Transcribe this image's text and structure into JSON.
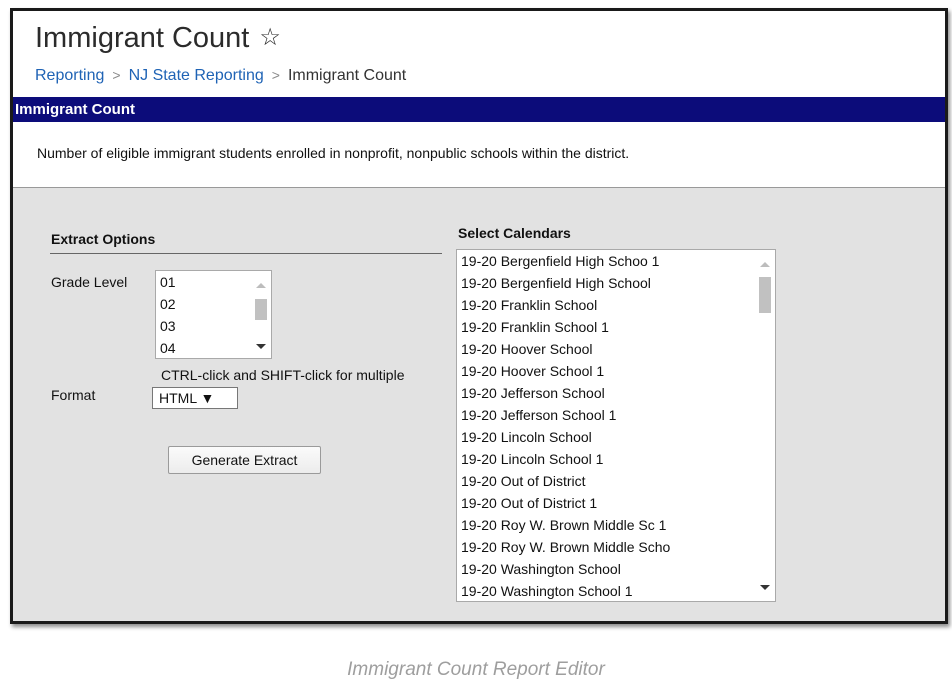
{
  "header": {
    "title": "Immigrant Count",
    "star_icon": "star-outline-icon",
    "breadcrumb": [
      "Reporting",
      "NJ State Reporting",
      "Immigrant Count"
    ],
    "separator": ">"
  },
  "section_bar": {
    "title": "Immigrant Count",
    "color": "#0c0c7a"
  },
  "description": "Number of eligible immigrant students enrolled in nonprofit, nonpublic schools within the district.",
  "extract_options": {
    "heading": "Extract Options",
    "grade_level_label": "Grade Level",
    "grade_levels": [
      "01",
      "02",
      "03",
      "04"
    ],
    "multi_hint": "CTRL-click and SHIFT-click for multiple",
    "format_label": "Format",
    "format_value": "HTML ▼",
    "generate_button": "Generate Extract"
  },
  "calendars": {
    "heading": "Select Calendars",
    "items": [
      "19-20 Bergenfield High Schoo 1",
      "19-20 Bergenfield High School",
      "19-20 Franklin School",
      "19-20 Franklin School 1",
      "19-20 Hoover School",
      "19-20 Hoover School 1",
      "19-20 Jefferson School",
      "19-20 Jefferson School 1",
      "19-20 Lincoln School",
      "19-20 Lincoln School 1",
      "19-20 Out of District",
      "19-20 Out of District 1",
      "19-20 Roy W. Brown Middle Sc 1",
      "19-20 Roy W. Brown Middle Scho",
      "19-20 Washington School",
      "19-20 Washington School 1"
    ]
  },
  "caption": "Immigrant Count Report Editor"
}
